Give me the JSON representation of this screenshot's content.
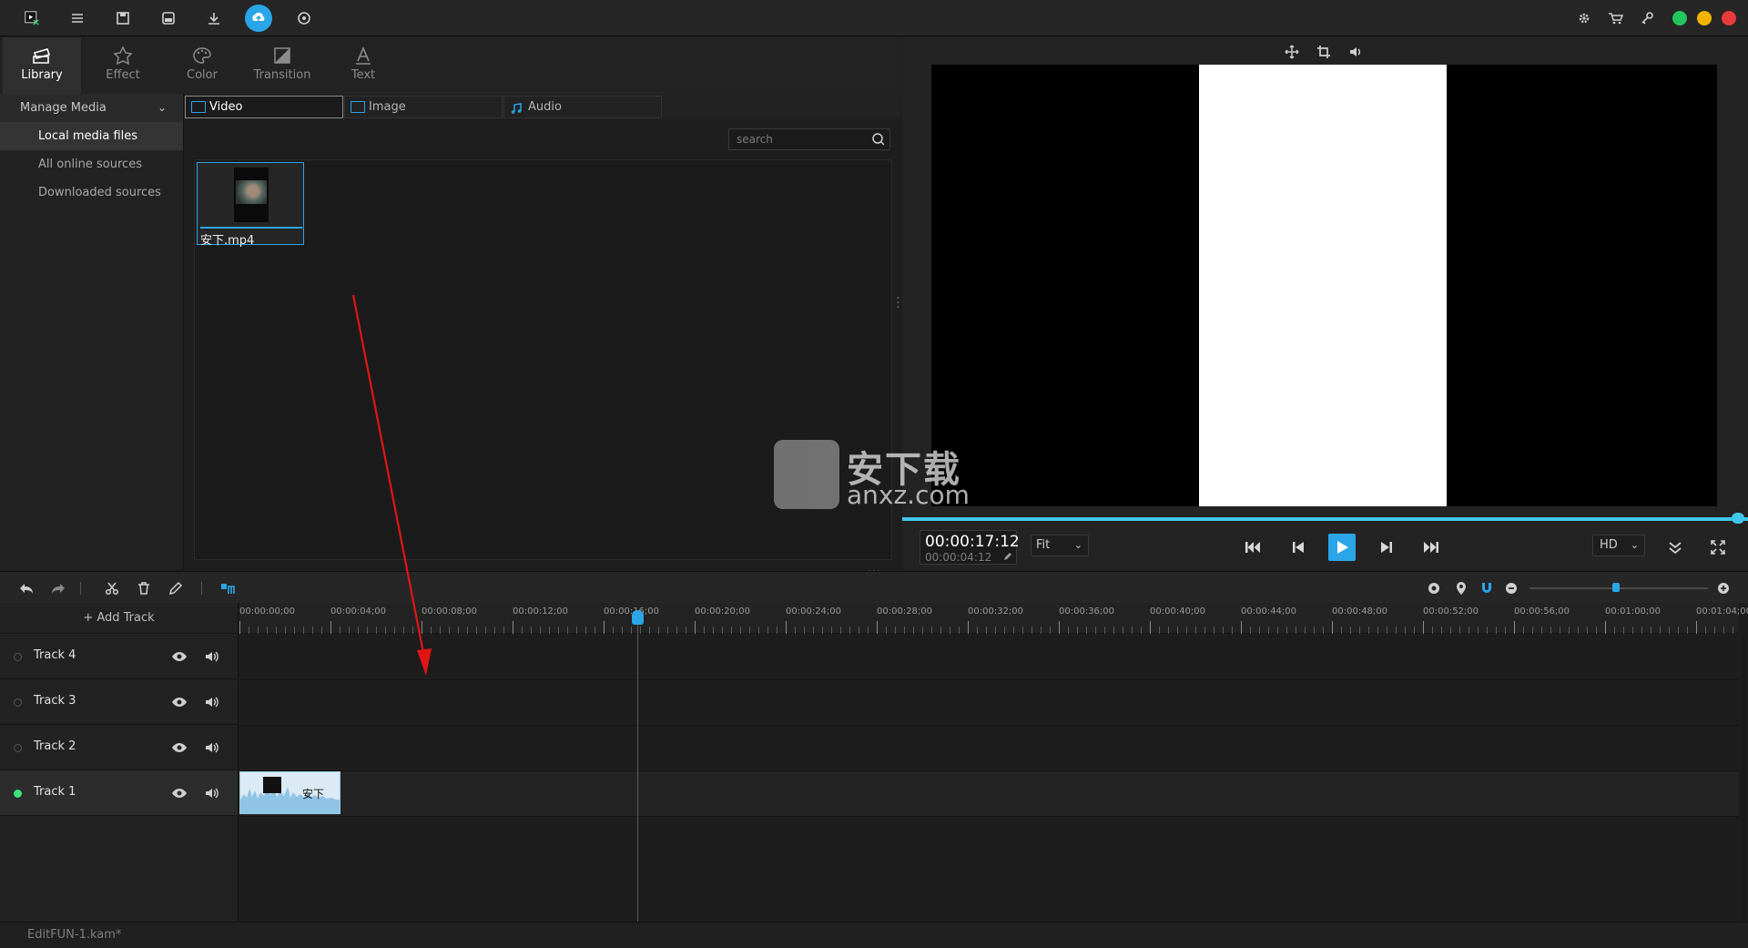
{
  "toolbar": {
    "icons": [
      "menu-icon",
      "save-icon",
      "save-as-icon",
      "download-icon",
      "export-icon",
      "help-icon"
    ],
    "right_icons": [
      "settings-icon",
      "cart-icon",
      "key-icon"
    ],
    "window_controls": {
      "restore_color": "#22c55e",
      "minimize_color": "#f2b400",
      "close_color": "#e83a3a"
    }
  },
  "tabs": [
    {
      "label": "Library",
      "icon": "library-icon",
      "active": true
    },
    {
      "label": "Effect",
      "icon": "effect-icon"
    },
    {
      "label": "Color",
      "icon": "color-icon"
    },
    {
      "label": "Transition",
      "icon": "transition-icon"
    },
    {
      "label": "Text",
      "icon": "text-icon"
    }
  ],
  "sidebar": {
    "header": "Manage Media",
    "items": [
      {
        "label": "Local media files",
        "active": true
      },
      {
        "label": "All online sources"
      },
      {
        "label": "Downloaded sources"
      }
    ]
  },
  "media_tabs": [
    {
      "label": "Video",
      "active": true
    },
    {
      "label": "Image"
    },
    {
      "label": "Audio"
    }
  ],
  "search": {
    "placeholder": "search"
  },
  "media_items": [
    {
      "name": "安下.mp4"
    }
  ],
  "preview": {
    "timecode_current": "00:00:17:12",
    "timecode_total": "00:00:04:12",
    "fit_label": "Fit",
    "quality_label": "HD",
    "progress": 1.0
  },
  "watermark": {
    "text": "安下载",
    "url": "anxz.com"
  },
  "timeline": {
    "add_track_label": "+ Add Track",
    "ruler_labels": [
      "00:00:00;00",
      "00:00:04;00",
      "00:00:08;00",
      "00:00:12;00",
      "00:00:16;00",
      "00:00:20;00",
      "00:00:24;00",
      "00:00:28;00",
      "00:00:32;00",
      "00:00:36;00",
      "00:00:40;00",
      "00:00:44;00",
      "00:00:48;00",
      "00:00:52;00",
      "00:00:56;00",
      "00:01:00;00",
      "00:01:04;00"
    ],
    "tracks": [
      {
        "name": "Track 4"
      },
      {
        "name": "Track 3"
      },
      {
        "name": "Track 2"
      },
      {
        "name": "Track 1",
        "active": true
      }
    ],
    "clip_label": "安下"
  },
  "status": {
    "filename": "EditFUN-1.kam*"
  },
  "colors": {
    "accent": "#2aa6e8",
    "progress": "#3fc7ea",
    "annotation_arrow": "#e01515"
  }
}
